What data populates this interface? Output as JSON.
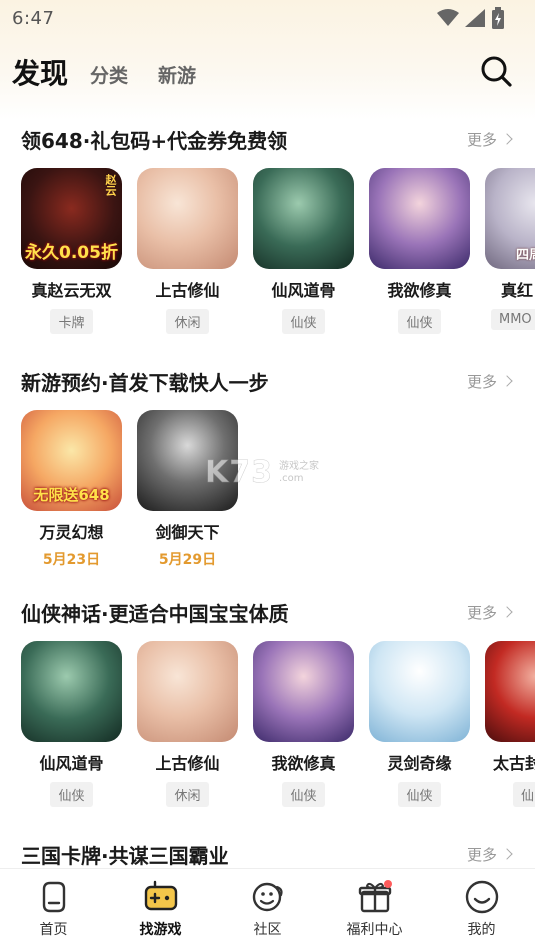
{
  "status_bar": {
    "time": "6:47"
  },
  "header": {
    "tabs": [
      {
        "label": "发现",
        "active": true
      },
      {
        "label": "分类",
        "active": false
      },
      {
        "label": "新游",
        "active": false
      }
    ]
  },
  "sections": [
    {
      "title": "领648·礼包码+代金券免费领",
      "more": "更多",
      "games": [
        {
          "name": "真赵云无双",
          "tag": "卡牌",
          "cover_text": "永久0.05折",
          "cover_side": "赵云"
        },
        {
          "name": "上古修仙",
          "tag": "休闲"
        },
        {
          "name": "仙风道骨",
          "tag": "仙侠"
        },
        {
          "name": "我欲修真",
          "tag": "仙侠"
        },
        {
          "name": "真红",
          "tag": "MMO",
          "cover_text": "四周年"
        }
      ]
    },
    {
      "title": "新游预约·首发下载快人一步",
      "more": "更多",
      "games": [
        {
          "name": "万灵幻想",
          "date": "5月23日",
          "cover_text": "无限送648"
        },
        {
          "name": "剑御天下",
          "date": "5月29日"
        }
      ]
    },
    {
      "title": "仙侠神话·更适合中国宝宝体质",
      "more": "更多",
      "games": [
        {
          "name": "仙风道骨",
          "tag": "仙侠"
        },
        {
          "name": "上古修仙",
          "tag": "休闲"
        },
        {
          "name": "我欲修真",
          "tag": "仙侠"
        },
        {
          "name": "灵剑奇缘",
          "tag": "仙侠"
        },
        {
          "name": "太古封",
          "tag": "仙"
        }
      ]
    },
    {
      "title": "三国卡牌·共谋三国霸业",
      "more": "更多"
    }
  ],
  "watermark": {
    "main": "K73",
    "sub1": "游戏之家",
    "sub2": ".com"
  },
  "bottom_nav": [
    {
      "label": "首页",
      "icon": "home-icon"
    },
    {
      "label": "找游戏",
      "icon": "gamepad-icon",
      "active": true
    },
    {
      "label": "社区",
      "icon": "community-icon"
    },
    {
      "label": "福利中心",
      "icon": "gift-icon"
    },
    {
      "label": "我的",
      "icon": "profile-icon"
    }
  ],
  "colors": {
    "accent": "#e39a2f",
    "badge": "#ff5b5b",
    "header_bg": "#fbf3e2"
  }
}
